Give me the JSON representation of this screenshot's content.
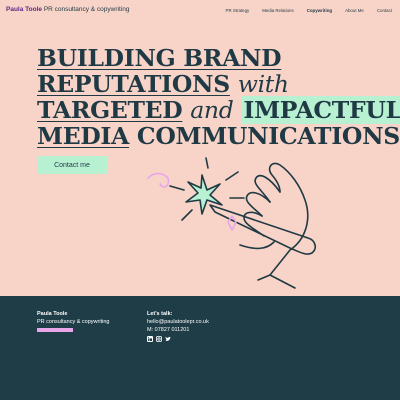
{
  "header": {
    "brand_name": "Paula Toole",
    "brand_tagline": "PR consultancy & copywriting",
    "nav": [
      "PR Strategy",
      "Media Relations",
      "Copywriting",
      "About Me",
      "Contact"
    ],
    "active_nav": "Copywriting"
  },
  "hero": {
    "line1": "BUILDING BRAND",
    "line2_a": "REPUTATIONS",
    "line2_b": "with",
    "line3_a": "TARGETED",
    "line3_b": "and",
    "line3_c": "IMPACTFUL",
    "line4_a": "MEDIA",
    "line4_b": "COMMUNICATIONS."
  },
  "cta": {
    "label": "Contact me"
  },
  "footer": {
    "name": "Paula Toole",
    "tagline": "PR consultancy & copywriting",
    "talk_heading": "Let's talk:",
    "email": "hello@paulatoolepr.co.uk",
    "phone": "M: 07827 011201",
    "social_icons": [
      "linkedin-icon",
      "instagram-icon",
      "twitter-icon"
    ]
  },
  "colors": {
    "background": "#f8d3c8",
    "text": "#1f3a44",
    "highlight": "#b8f0d2",
    "footer": "#1f3d47",
    "accent": "#e8a6e8",
    "brand": "#5b2a86"
  }
}
